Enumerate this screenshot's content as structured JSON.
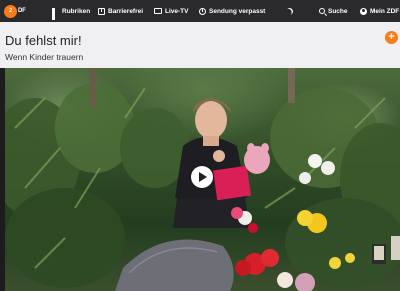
{
  "navbar": {
    "logo": {
      "mark": "2",
      "text": "DF"
    },
    "items": [
      {
        "label": "Rubriken",
        "icon": "grid-icon"
      },
      {
        "label": "Barrierefrei",
        "icon": "accessibility-icon"
      },
      {
        "label": "Live-TV",
        "icon": "tv-icon"
      },
      {
        "label": "Sendung verpasst",
        "icon": "clock-icon"
      },
      {
        "label": "",
        "icon": "moon-icon"
      },
      {
        "label": "Suche",
        "icon": "search-icon"
      },
      {
        "label": "Mein ZDF",
        "icon": "user-icon"
      }
    ]
  },
  "header": {
    "title": "Du fehlst mir!",
    "subtitle": "Wenn Kinder trauern",
    "add_symbol": "+"
  },
  "colors": {
    "brand_orange": "#fa7d19",
    "navbar_bg": "#2a2a2d",
    "header_bg": "#f0f0f2"
  }
}
